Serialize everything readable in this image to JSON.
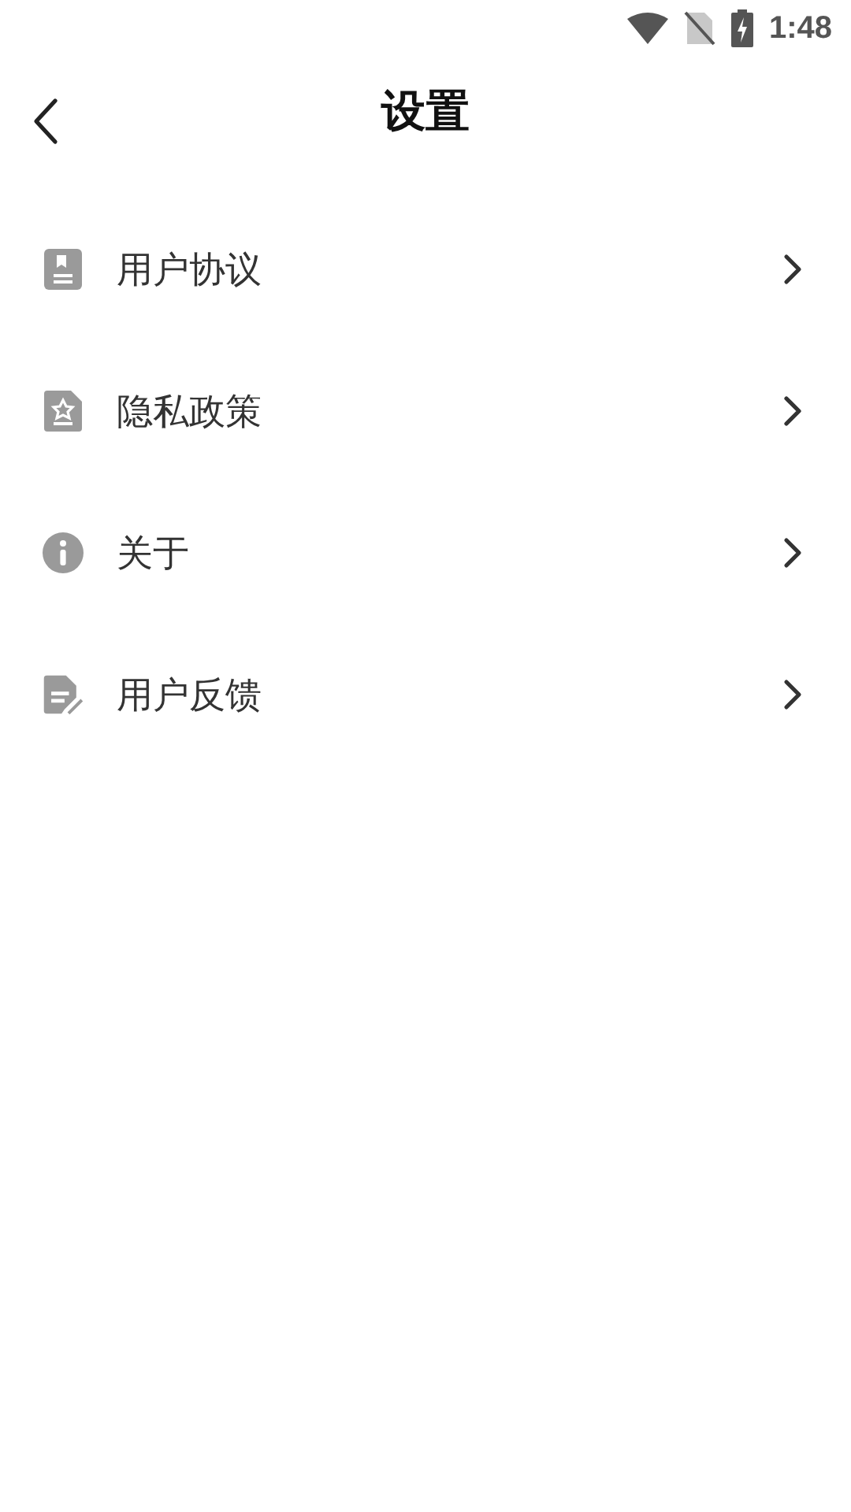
{
  "status_bar": {
    "time": "1:48"
  },
  "header": {
    "title": "设置"
  },
  "menu": [
    {
      "kind": "agreement",
      "label": "用户协议"
    },
    {
      "kind": "privacy",
      "label": "隐私政策"
    },
    {
      "kind": "about",
      "label": "关于"
    },
    {
      "kind": "feedback",
      "label": "用户反馈"
    }
  ]
}
